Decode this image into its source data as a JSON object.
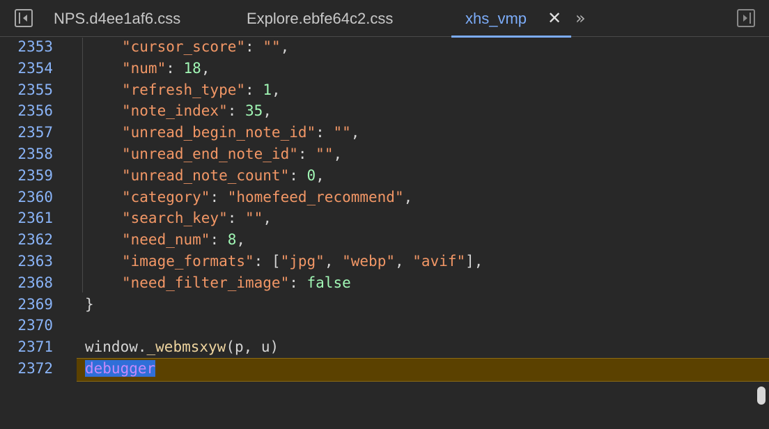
{
  "tabs": [
    {
      "label": "NPS.d4ee1af6.css",
      "active": false
    },
    {
      "label": "Explore.ebfe64c2.css",
      "active": false
    },
    {
      "label": "xhs_vmp",
      "active": true
    }
  ],
  "tab_close_glyph": "✕",
  "more_tabs_glyph": "»",
  "icons": {
    "left": "toggle-navigator-icon",
    "right": "toggle-debugger-icon"
  },
  "lines": [
    {
      "num": "2353",
      "key": "\"cursor_score\"",
      "sep": ": ",
      "val": "\"\"",
      "val_type": "string",
      "end": ","
    },
    {
      "num": "2354",
      "key": "\"num\"",
      "sep": ": ",
      "val": "18",
      "val_type": "number",
      "end": ","
    },
    {
      "num": "2355",
      "key": "\"refresh_type\"",
      "sep": ": ",
      "val": "1",
      "val_type": "number",
      "end": ","
    },
    {
      "num": "2356",
      "key": "\"note_index\"",
      "sep": ": ",
      "val": "35",
      "val_type": "number",
      "end": ","
    },
    {
      "num": "2357",
      "key": "\"unread_begin_note_id\"",
      "sep": ": ",
      "val": "\"\"",
      "val_type": "string",
      "end": ","
    },
    {
      "num": "2358",
      "key": "\"unread_end_note_id\"",
      "sep": ": ",
      "val": "\"\"",
      "val_type": "string",
      "end": ","
    },
    {
      "num": "2359",
      "key": "\"unread_note_count\"",
      "sep": ": ",
      "val": "0",
      "val_type": "number",
      "end": ","
    },
    {
      "num": "2360",
      "key": "\"category\"",
      "sep": ": ",
      "val": "\"homefeed_recommend\"",
      "val_type": "string",
      "end": ","
    },
    {
      "num": "2361",
      "key": "\"search_key\"",
      "sep": ": ",
      "val": "\"\"",
      "val_type": "string",
      "end": ","
    },
    {
      "num": "2362",
      "key": "\"need_num\"",
      "sep": ": ",
      "val": "8",
      "val_type": "number",
      "end": ","
    },
    {
      "num": "2363",
      "key": "\"image_formats\"",
      "sep": ": ",
      "val": "[\"jpg\", \"webp\", \"avif\"]",
      "val_type": "array",
      "end": ","
    },
    {
      "num": "2368",
      "key": "\"need_filter_image\"",
      "sep": ": ",
      "val": "false",
      "val_type": "boolean",
      "end": ""
    }
  ],
  "close_brace": {
    "num": "2369",
    "text": "}"
  },
  "blank_line": {
    "num": "2370"
  },
  "call_line": {
    "num": "2371",
    "obj": "window.",
    "fn": "_webmsxyw",
    "args": "(p, u)"
  },
  "debugger_line": {
    "num": "2372",
    "text": "debugger"
  },
  "colors": {
    "background": "#282828",
    "line_numbers": "#8ab4f8",
    "key_string": "#f29766",
    "number": "#a1f7b5",
    "function": "#eed49f",
    "active_tab": "#7cacf8",
    "paused_line": "#5b4100",
    "selection": "#2f6fd8",
    "debugger_keyword": "#c58af9"
  }
}
